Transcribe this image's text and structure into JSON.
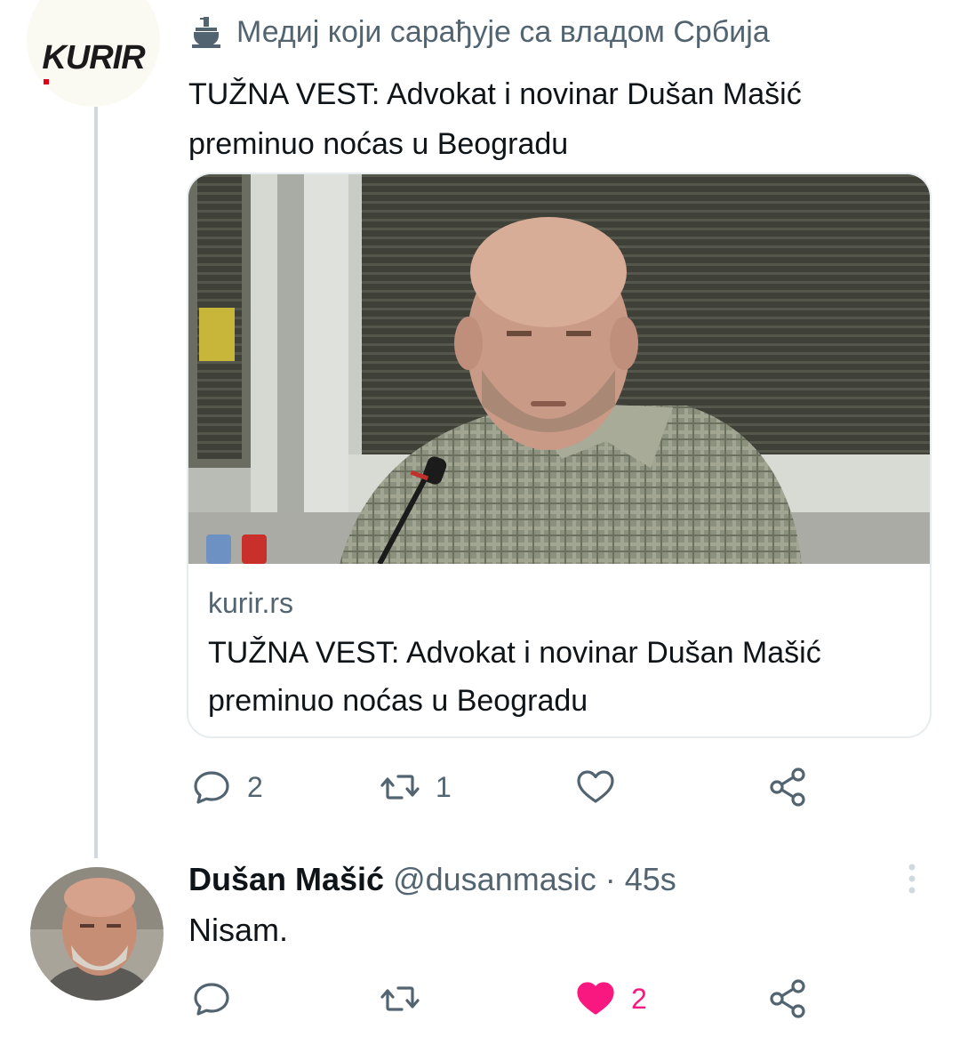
{
  "kurir_tweet": {
    "avatar_logo": "KURIR",
    "label": "Медиј који сарађује са владом Србија",
    "text": "TUŽNA VEST: Advokat i novinar Dušan Mašić preminuo noćas u Beogradu",
    "card": {
      "domain": "kurir.rs",
      "title": "TUŽNA VEST: Advokat i novinar Dušan Mašić preminuo noćas u Beogradu"
    },
    "actions": {
      "reply_count": "2",
      "retweet_count": "1",
      "like_count": ""
    }
  },
  "reply_tweet": {
    "name": "Dušan Mašić",
    "handle": "@dusanmasic",
    "separator": "·",
    "time": "45s",
    "text": "Nisam.",
    "actions": {
      "reply_count": "",
      "retweet_count": "",
      "like_count": "2",
      "liked": true
    }
  },
  "colors": {
    "secondary_text": "#536471",
    "like_pink": "#f91880",
    "thread_line": "#cfd9de",
    "kurir_red": "#e2001a"
  },
  "icons": [
    "government-building-icon",
    "reply-icon",
    "retweet-icon",
    "heart-icon",
    "share-icon",
    "more-vertical-icon"
  ]
}
